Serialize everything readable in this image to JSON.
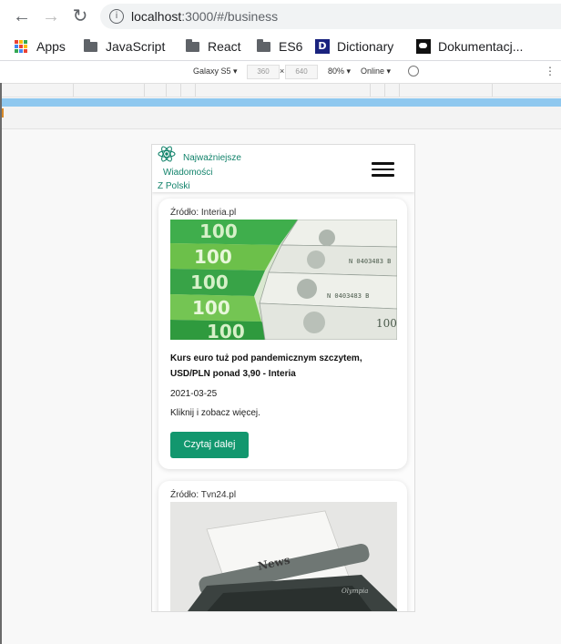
{
  "browser": {
    "url_host": "localhost",
    "url_rest": ":3000/#/business",
    "bookmarks": [
      "Apps",
      "JavaScript",
      "React",
      "ES6",
      "Dictionary",
      "Dokumentacj..."
    ]
  },
  "devtools": {
    "device": "Galaxy S5 ▾",
    "width": "360",
    "times": "×",
    "height": "640",
    "zoom": "80% ▾",
    "network": "Online ▾"
  },
  "app": {
    "brand_line1": "Najważniejsze",
    "brand_line2": "Wiadomości",
    "brand_line3": "Z Polski",
    "brand_color": "#12836b"
  },
  "articles": [
    {
      "source": "Źródło: Interia.pl",
      "title": "Kurs euro tuż pod pandemicznym szczytem, USD/PLN ponad 3,90 - Interia",
      "date": "2021-03-25",
      "description": "Kliknij i zobacz więcej.",
      "button": "Czytaj dalej",
      "image": "banknotes-image"
    },
    {
      "source": "Źródło: Tvn24.pl",
      "image": "typewriter-image",
      "image_text_news": "News",
      "image_text_brand": "Olympia"
    }
  ],
  "colors": {
    "button": "#12976e",
    "devtools_blue": "#8fc8ef"
  }
}
